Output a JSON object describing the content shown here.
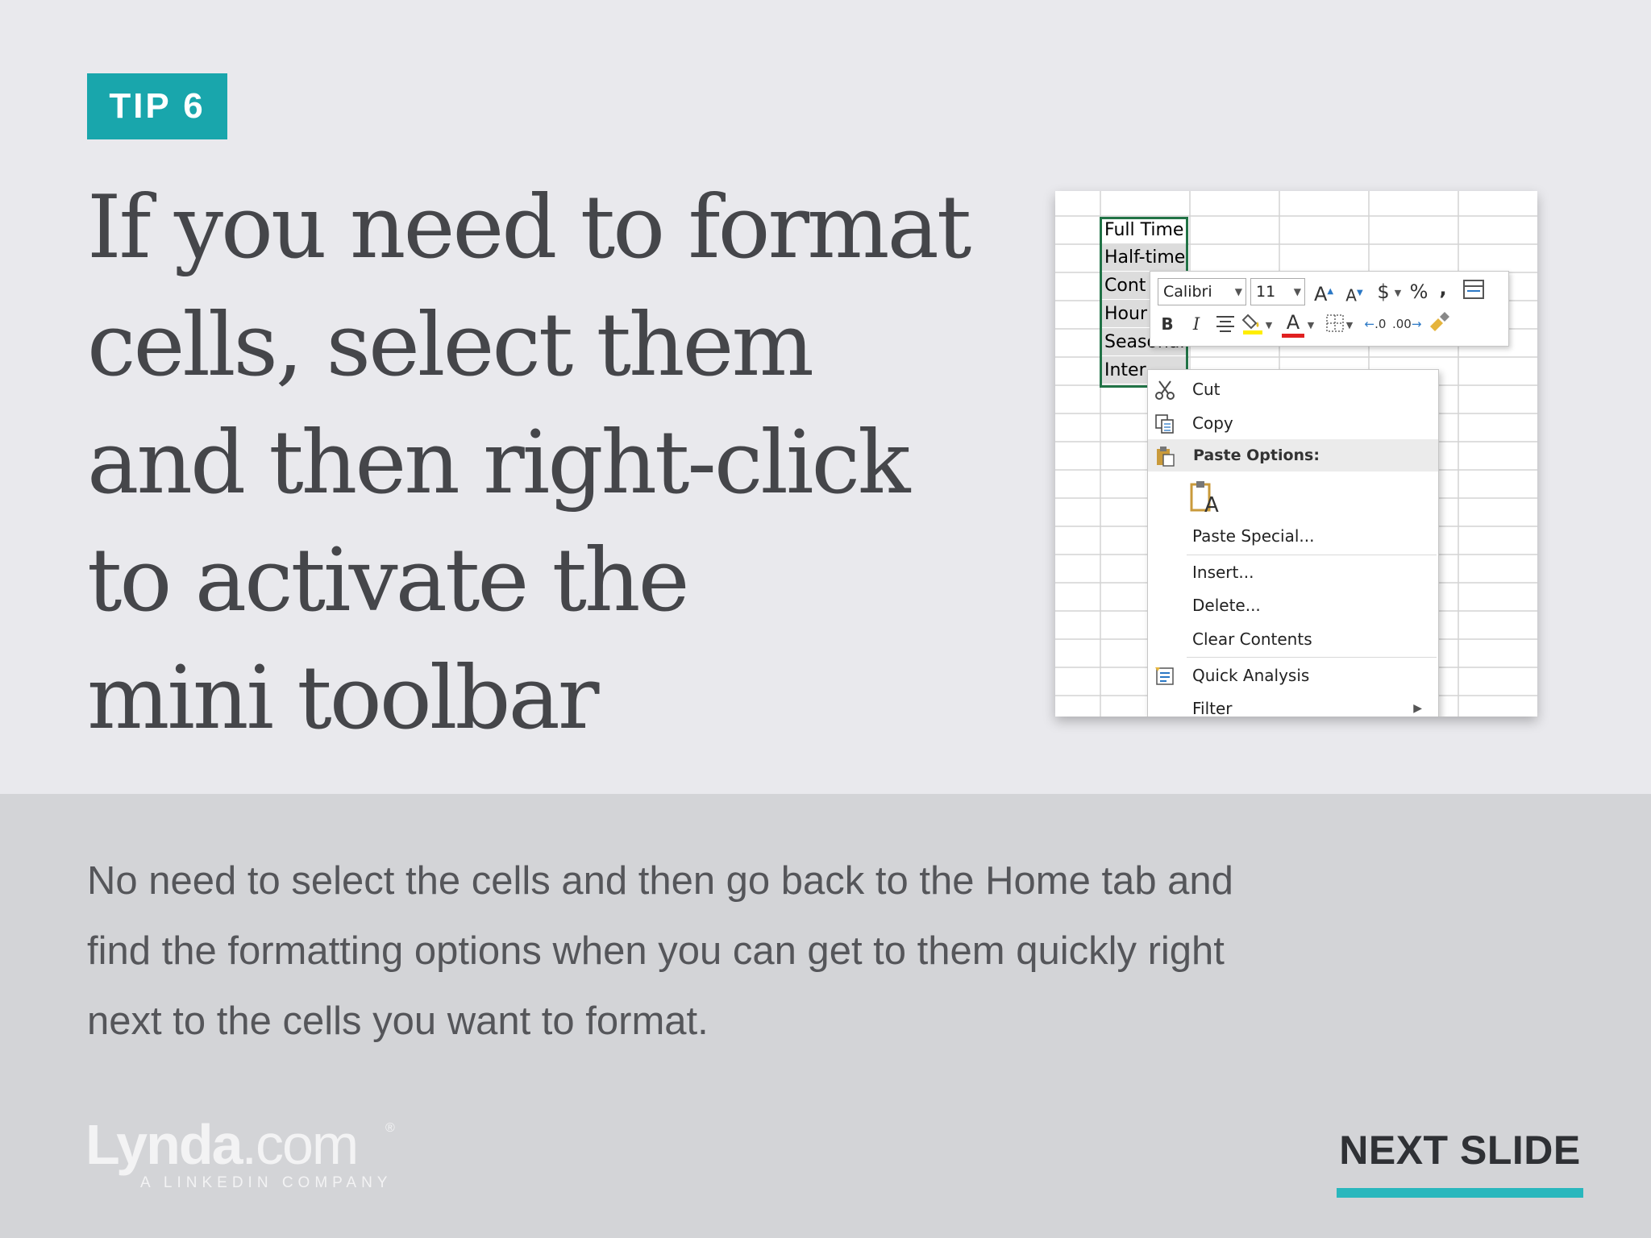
{
  "badge": {
    "label": "TIP 6"
  },
  "headline": {
    "lines": [
      "If you need to format",
      "cells, select them",
      "and then right-click",
      "to activate the",
      "mini toolbar"
    ]
  },
  "body": {
    "lines": [
      "No need to select the cells and then go back to the Home tab and",
      "find the formatting options when you can get to them quickly right",
      "next to the cells you want to format."
    ]
  },
  "logo": {
    "word": "Lynda",
    "suffix": ".com",
    "registered": "®",
    "tagline": "A LINKEDIN COMPANY"
  },
  "nav": {
    "next_label": "NEXT SLIDE"
  },
  "excel": {
    "cells": [
      "Full Time",
      "Half-time",
      "Cont",
      "Hour",
      "Seasonal",
      "Inter"
    ],
    "mini_toolbar": {
      "font_name": "Calibri",
      "font_size": "11",
      "grow_font": "A",
      "shrink_font": "A",
      "currency": "$",
      "percent": "%",
      "comma": ",",
      "bold": "B",
      "italic": "I",
      "font_color": "A",
      "increase_decimal": ".0",
      "decrease_decimal": ".00"
    },
    "context_menu": {
      "cut": "Cut",
      "copy": "Copy",
      "paste_options": "Paste Options:",
      "paste_special": "Paste Special...",
      "insert": "Insert...",
      "delete": "Delete...",
      "clear_contents": "Clear Contents",
      "quick_analysis": "Quick Analysis",
      "filter": "Filter"
    }
  },
  "colors": {
    "accent_teal": "#19a6ac",
    "excel_green": "#217346",
    "top_bg": "#e9e9ed",
    "bottom_bg": "#d3d4d7"
  }
}
